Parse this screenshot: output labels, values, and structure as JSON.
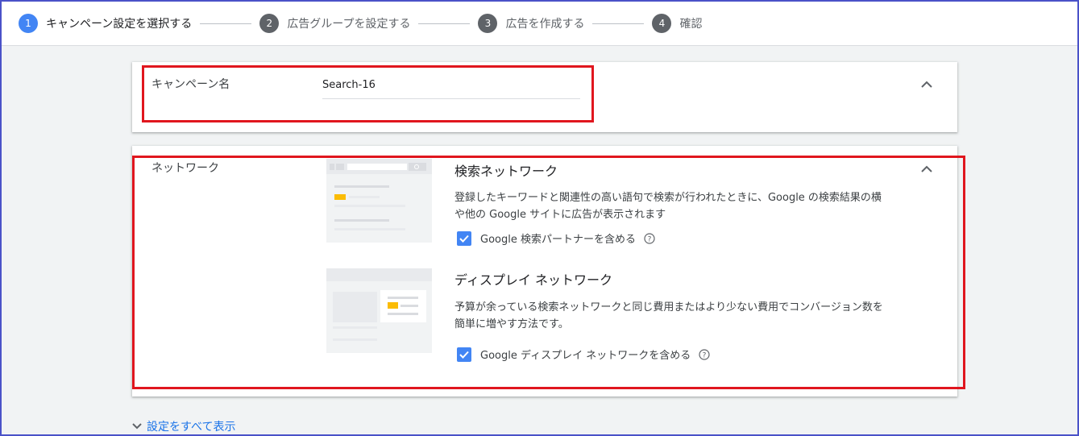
{
  "stepper": {
    "steps": [
      {
        "num": "1",
        "label": "キャンペーン設定を選択する"
      },
      {
        "num": "2",
        "label": "広告グループを設定する"
      },
      {
        "num": "3",
        "label": "広告を作成する"
      },
      {
        "num": "4",
        "label": "確認"
      }
    ]
  },
  "campaign_name": {
    "label": "キャンペーン名",
    "value": "Search-16"
  },
  "network": {
    "label": "ネットワーク",
    "search": {
      "title": "検索ネットワーク",
      "description": "登録したキーワードと関連性の高い語句で検索が行われたときに、Google の検索結果の横や他の Google サイトに広告が表示されます",
      "checkbox_label": "Google 検索パートナーを含める",
      "checked": true
    },
    "display": {
      "title": "ディスプレイ ネットワーク",
      "description": "予算が余っている検索ネットワークと同じ費用またはより少ない費用でコンバージョン数を簡単に増やす方法です。",
      "checkbox_label": "Google ディスプレイ ネットワークを含める",
      "checked": true
    }
  },
  "show_all_label": "設定をすべて表示",
  "colors": {
    "accent": "#4285f4",
    "link": "#1a73e8",
    "highlight": "#e0161e",
    "ad_yellow": "#fbbc04"
  }
}
